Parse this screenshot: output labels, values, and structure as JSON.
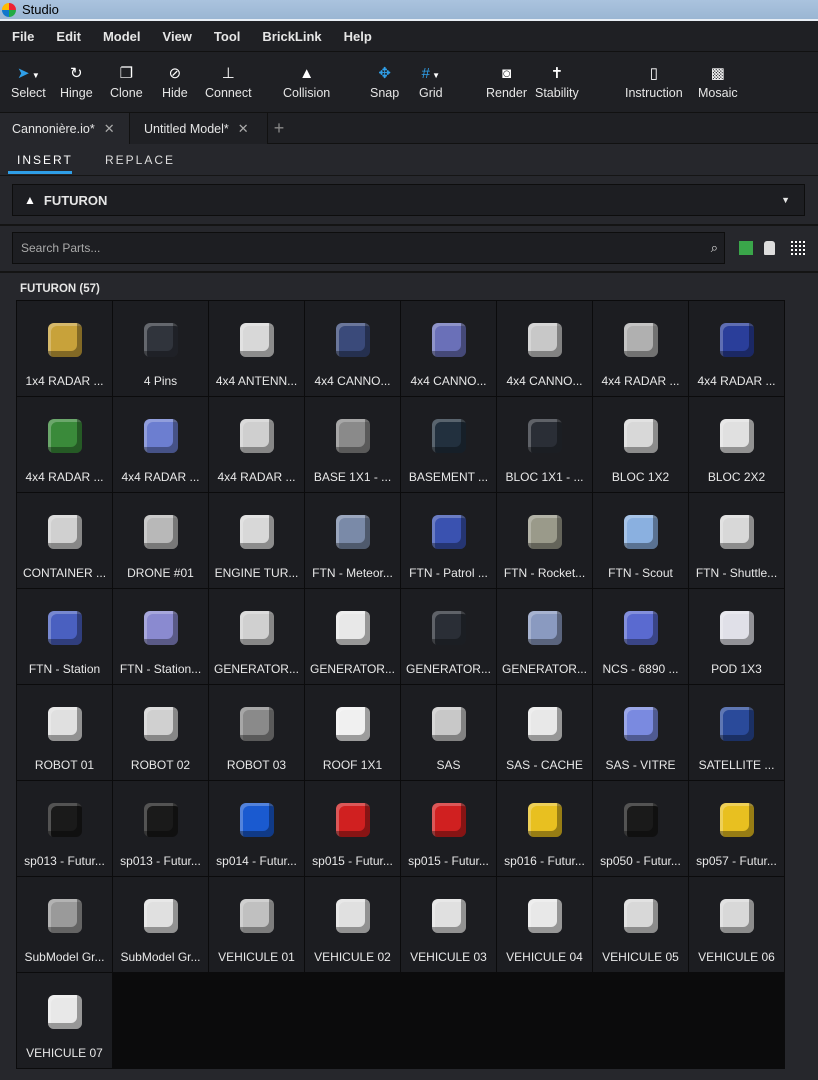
{
  "window": {
    "title": "Studio"
  },
  "menu": [
    "File",
    "Edit",
    "Model",
    "View",
    "Tool",
    "BrickLink",
    "Help"
  ],
  "toolbar": {
    "select": "Select",
    "hinge": "Hinge",
    "clone": "Clone",
    "hide": "Hide",
    "connect": "Connect",
    "collision": "Collision",
    "snap": "Snap",
    "grid": "Grid",
    "render": "Render",
    "stability": "Stability",
    "instruction": "Instruction",
    "mosaic": "Mosaic"
  },
  "tabs": [
    {
      "label": "Cannonière.io*"
    },
    {
      "label": "Untitled Model*"
    }
  ],
  "subtabs": {
    "insert": "INSERT",
    "replace": "REPLACE"
  },
  "category": {
    "selected": "FUTURON"
  },
  "search": {
    "placeholder": "Search Parts...",
    "value": ""
  },
  "group": {
    "label": "FUTURON (57)"
  },
  "parts": [
    {
      "name": "1x4 RADAR ...",
      "color": "#c8a23a"
    },
    {
      "name": "4 Pins",
      "color": "#30343c"
    },
    {
      "name": "4x4 ANTENN...",
      "color": "#d8d8d8"
    },
    {
      "name": "4x4 CANNO...",
      "color": "#3a4a7a"
    },
    {
      "name": "4x4 CANNO...",
      "color": "#6a70b8"
    },
    {
      "name": "4x4 CANNO...",
      "color": "#c8c8c8"
    },
    {
      "name": "4x4 RADAR ...",
      "color": "#b0b0b0"
    },
    {
      "name": "4x4 RADAR ...",
      "color": "#2a3e9a"
    },
    {
      "name": "4x4 RADAR ...",
      "color": "#3a8a3a"
    },
    {
      "name": "4x4 RADAR ...",
      "color": "#6c7ed0"
    },
    {
      "name": "4x4 RADAR ...",
      "color": "#cfcfcf"
    },
    {
      "name": "BASE 1X1 - ...",
      "color": "#8a8a8a"
    },
    {
      "name": "BASEMENT ...",
      "color": "#22303e"
    },
    {
      "name": "BLOC 1X1 - ...",
      "color": "#2a2e36"
    },
    {
      "name": "BLOC 1X2",
      "color": "#d8d8d8"
    },
    {
      "name": "BLOC 2X2",
      "color": "#e0e0e0"
    },
    {
      "name": "CONTAINER ...",
      "color": "#d0d0d0"
    },
    {
      "name": "DRONE #01",
      "color": "#b8b8b8"
    },
    {
      "name": "ENGINE TUR...",
      "color": "#d8d8d8"
    },
    {
      "name": "FTN - Meteor...",
      "color": "#7a8aa8"
    },
    {
      "name": "FTN - Patrol ...",
      "color": "#3a52b0"
    },
    {
      "name": "FTN - Rocket...",
      "color": "#9a9a8a"
    },
    {
      "name": "FTN - Scout",
      "color": "#8ab0e0"
    },
    {
      "name": "FTN - Shuttle...",
      "color": "#d8d8d8"
    },
    {
      "name": "FTN - Station",
      "color": "#4a60c0"
    },
    {
      "name": "FTN - Station...",
      "color": "#8a8ad0"
    },
    {
      "name": "GENERATOR...",
      "color": "#d0d0d0"
    },
    {
      "name": "GENERATOR...",
      "color": "#e8e8e8"
    },
    {
      "name": "GENERATOR...",
      "color": "#2a2e36"
    },
    {
      "name": "GENERATOR...",
      "color": "#8a9ac0"
    },
    {
      "name": "NCS - 6890 ...",
      "color": "#5a6ad0"
    },
    {
      "name": "POD 1X3",
      "color": "#e0e0e8"
    },
    {
      "name": "ROBOT 01",
      "color": "#e0e0e0"
    },
    {
      "name": "ROBOT 02",
      "color": "#d0d0d0"
    },
    {
      "name": "ROBOT 03",
      "color": "#8a8a8a"
    },
    {
      "name": "ROOF 1X1",
      "color": "#f0f0f0"
    },
    {
      "name": "SAS",
      "color": "#c8c8c8"
    },
    {
      "name": "SAS - CACHE",
      "color": "#e8e8e8"
    },
    {
      "name": "SAS - VITRE",
      "color": "#7a8ae0"
    },
    {
      "name": "SATELLITE ...",
      "color": "#2a4a9a"
    },
    {
      "name": "sp013 - Futur...",
      "color": "#1a1a1a"
    },
    {
      "name": "sp013 - Futur...",
      "color": "#1a1a1a"
    },
    {
      "name": "sp014 - Futur...",
      "color": "#1a5ad0"
    },
    {
      "name": "sp015 - Futur...",
      "color": "#d02020"
    },
    {
      "name": "sp015 - Futur...",
      "color": "#d02020"
    },
    {
      "name": "sp016 - Futur...",
      "color": "#e8c020"
    },
    {
      "name": "sp050 - Futur...",
      "color": "#1a1a1a"
    },
    {
      "name": "sp057 - Futur...",
      "color": "#e8c020"
    },
    {
      "name": "SubModel Gr...",
      "color": "#9a9a9a"
    },
    {
      "name": "SubModel Gr...",
      "color": "#e0e0e0"
    },
    {
      "name": "VEHICULE 01",
      "color": "#c0c0c0"
    },
    {
      "name": "VEHICULE 02",
      "color": "#e0e0e0"
    },
    {
      "name": "VEHICULE 03",
      "color": "#e0e0e0"
    },
    {
      "name": "VEHICULE 04",
      "color": "#e8e8e8"
    },
    {
      "name": "VEHICULE 05",
      "color": "#d8d8d8"
    },
    {
      "name": "VEHICULE 06",
      "color": "#d8d8d8"
    },
    {
      "name": "VEHICULE 07",
      "color": "#e8e8e8"
    }
  ]
}
